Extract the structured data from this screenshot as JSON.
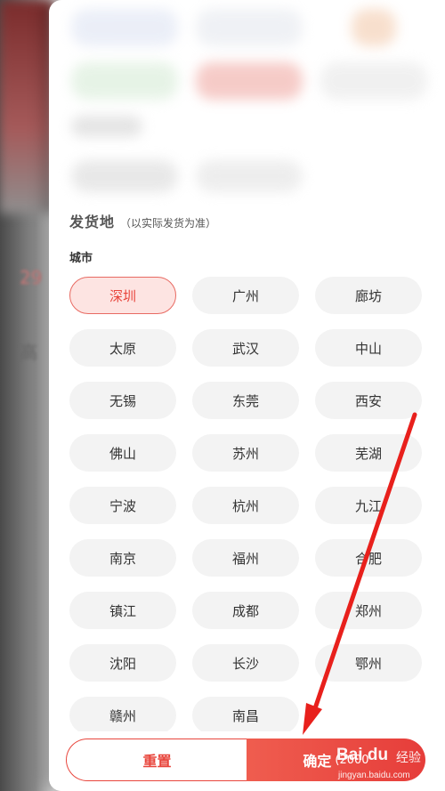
{
  "section": {
    "title": "发货地",
    "note": "（以实际发货为准）",
    "sub_label": "城市"
  },
  "cities": [
    {
      "label": "深圳",
      "selected": true
    },
    {
      "label": "广州",
      "selected": false
    },
    {
      "label": "廊坊",
      "selected": false
    },
    {
      "label": "太原",
      "selected": false
    },
    {
      "label": "武汉",
      "selected": false
    },
    {
      "label": "中山",
      "selected": false
    },
    {
      "label": "无锡",
      "selected": false
    },
    {
      "label": "东莞",
      "selected": false
    },
    {
      "label": "西安",
      "selected": false
    },
    {
      "label": "佛山",
      "selected": false
    },
    {
      "label": "苏州",
      "selected": false
    },
    {
      "label": "芜湖",
      "selected": false
    },
    {
      "label": "宁波",
      "selected": false
    },
    {
      "label": "杭州",
      "selected": false
    },
    {
      "label": "九江",
      "selected": false
    },
    {
      "label": "南京",
      "selected": false
    },
    {
      "label": "福州",
      "selected": false
    },
    {
      "label": "合肥",
      "selected": false
    },
    {
      "label": "镇江",
      "selected": false
    },
    {
      "label": "成都",
      "selected": false
    },
    {
      "label": "郑州",
      "selected": false
    },
    {
      "label": "沈阳",
      "selected": false
    },
    {
      "label": "长沙",
      "selected": false
    },
    {
      "label": "鄂州",
      "selected": false
    },
    {
      "label": "赣州",
      "selected": false
    },
    {
      "label": "南昌",
      "selected": false
    }
  ],
  "footer": {
    "reset_label": "重置",
    "confirm_label": "确定",
    "confirm_count": "(2000"
  },
  "background": {
    "partial_number": "29",
    "partial_char": "高"
  },
  "watermark": {
    "brand": "Bai du",
    "cn": "经验",
    "url": "jingyan.baidu.com"
  },
  "colors": {
    "accent": "#e8453c",
    "chip_bg": "#f3f3f3",
    "selected_bg": "#fde4e2",
    "annotation_arrow": "#e8201c"
  }
}
